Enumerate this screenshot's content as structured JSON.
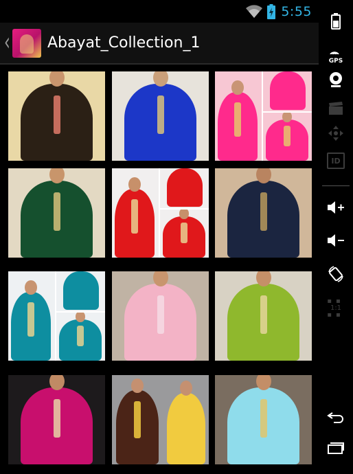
{
  "status_bar": {
    "time": "5:55"
  },
  "action_bar": {
    "title": "Abayat_Collection_1"
  },
  "device_nav": {
    "gps_label": "GPS",
    "id_label": "ID",
    "ratio_label": "1:1"
  },
  "grid": {
    "tiles": [
      {
        "name": "floral-black-kaftan",
        "bg": "#e9d8a6",
        "dress": "#2b2015",
        "accent": "#e07b6a",
        "skin": "#c9956d"
      },
      {
        "name": "royal-blue-kaftan",
        "bg": "#e7e3db",
        "dress": "#1c37c8",
        "accent": "#d9c27a",
        "skin": "#caa07a"
      },
      {
        "name": "pink-kaftan-collage",
        "bg": "#f7c7d3",
        "dress": "#ff2a8c",
        "accent": "#e6c46c",
        "skin": "#c99575"
      },
      {
        "name": "green-kaftan",
        "bg": "#e3d9c3",
        "dress": "#15502e",
        "accent": "#d6c07a",
        "skin": "#c8956b"
      },
      {
        "name": "red-kaftan-collage",
        "bg": "#f1efef",
        "dress": "#e0181b",
        "accent": "#e7d091",
        "skin": "#c7906a"
      },
      {
        "name": "navy-kaftan",
        "bg": "#d0b79a",
        "dress": "#1b2540",
        "accent": "#b89a5c",
        "skin": "#b98460"
      },
      {
        "name": "teal-kaftan-collage",
        "bg": "#eef1f3",
        "dress": "#0e8ea0",
        "accent": "#e6d18f",
        "skin": "#c89470"
      },
      {
        "name": "light-pink-kaftan",
        "bg": "#c0b3a4",
        "dress": "#f3b3c6",
        "accent": "#f5dbe4",
        "skin": "#c8956e"
      },
      {
        "name": "lime-kaftan",
        "bg": "#d8d2c4",
        "dress": "#8fb82d",
        "accent": "#e4d39a",
        "skin": "#c59068"
      },
      {
        "name": "magenta-kaftan",
        "bg": "#1d1a1c",
        "dress": "#c80f6d",
        "accent": "#e8d2a6",
        "skin": "#c08a64"
      },
      {
        "name": "brown-and-yellow-kaftans",
        "bg": "#9a9a9c",
        "dress": "#4b2417",
        "accent": "#f1cb3f",
        "skin": "#c59070"
      },
      {
        "name": "sky-blue-kaftan",
        "bg": "#7a6d60",
        "dress": "#8fdceb",
        "accent": "#e0c66c",
        "skin": "#c38e67"
      }
    ]
  }
}
